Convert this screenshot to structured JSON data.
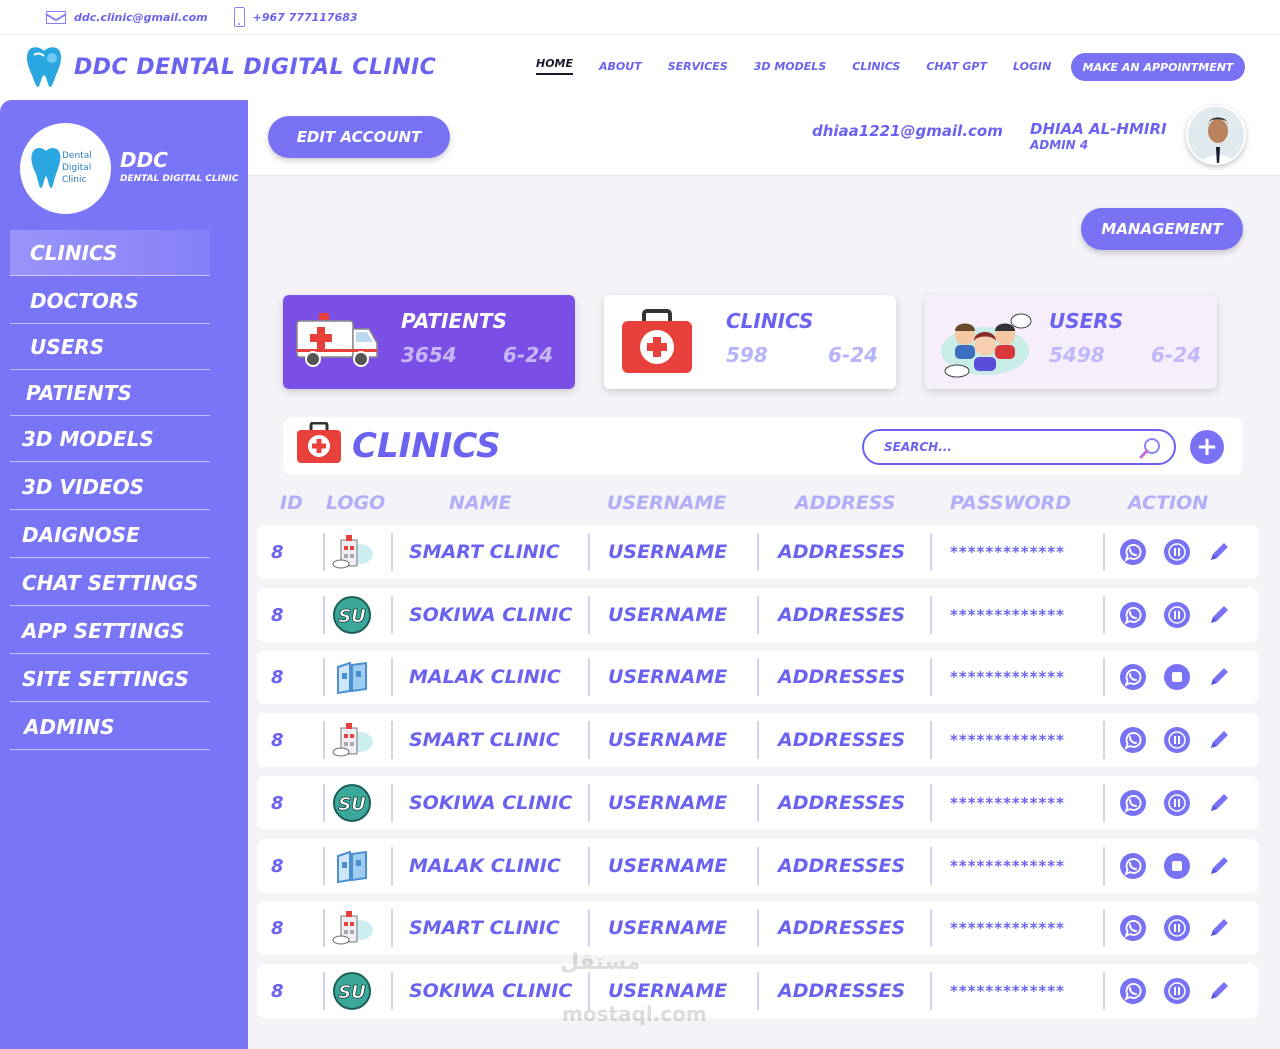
{
  "topbar": {
    "email": "ddc.clinic@gmail.com",
    "phone": "+967 777117683",
    "email_icon": "mail-icon",
    "phone_icon": "phone-icon"
  },
  "navbar": {
    "brand": "DDC DENTAL DIGITAL CLINIC",
    "links": [
      "HOME",
      "ABOUT",
      "SERVICES",
      "3D MODELS",
      "CLINICS",
      "CHAT GPT",
      "LOGIN"
    ],
    "active_link": "HOME",
    "cta": "MAKE AN APPOINTMENT"
  },
  "sidebar": {
    "brand_title": "DDC",
    "brand_subtitle": "DENTAL DIGITAL CLINIC",
    "logo_lines": [
      "Dental",
      "Digital",
      "Clinic"
    ],
    "items": [
      {
        "label": "CLINICS",
        "active": true
      },
      {
        "label": "DOCTORS",
        "active": false
      },
      {
        "label": "USERS",
        "active": false
      },
      {
        "label": "PATIENTS",
        "active": false
      },
      {
        "label": "3D MODELS",
        "active": false
      },
      {
        "label": "3D VIDEOS",
        "active": false
      },
      {
        "label": "DAIGNOSE",
        "active": false
      },
      {
        "label": "CHAT SETTINGS",
        "active": false
      },
      {
        "label": "APP SETTINGS",
        "active": false
      },
      {
        "label": "SITE SETTINGS",
        "active": false
      },
      {
        "label": "ADMINS",
        "active": false
      }
    ]
  },
  "header": {
    "edit_button": "EDIT ACCOUNT",
    "user_email": "dhiaa1221@gmail.com",
    "user_name": "DHIAA AL-HMIRI",
    "user_role": "ADMIN 4"
  },
  "main": {
    "management_button": "MANAGEMENT",
    "stats": [
      {
        "title": "PATIENTS",
        "value": "3654",
        "date": "6-24",
        "icon": "ambulance-icon"
      },
      {
        "title": "CLINICS",
        "value": "598",
        "date": "6-24",
        "icon": "first-aid-kit-icon"
      },
      {
        "title": "USERS",
        "value": "5498",
        "date": "6-24",
        "icon": "users-group-icon"
      }
    ],
    "section_title": "CLINICS",
    "search_placeholder": "SEARCH...",
    "add_button": "+",
    "columns": [
      "ID",
      "LOGO",
      "NAME",
      "USERNAME",
      "ADDRESS",
      "PASSWORD",
      "ACTION"
    ],
    "rows": [
      {
        "id": "8",
        "logo": "smart-clinic-logo",
        "name": "SMART CLINIC",
        "username": "USERNAME",
        "address": "ADDRESSES",
        "password": "*************",
        "status": "pause"
      },
      {
        "id": "8",
        "logo": "sokiwa-clinic-logo",
        "name": "SOKIWA CLINIC",
        "username": "USERNAME",
        "address": "ADDRESSES",
        "password": "*************",
        "status": "pause"
      },
      {
        "id": "8",
        "logo": "malak-clinic-logo",
        "name": "MALAK CLINIC",
        "username": "USERNAME",
        "address": "ADDRESSES",
        "password": "*************",
        "status": "stop"
      },
      {
        "id": "8",
        "logo": "smart-clinic-logo",
        "name": "SMART CLINIC",
        "username": "USERNAME",
        "address": "ADDRESSES",
        "password": "*************",
        "status": "pause"
      },
      {
        "id": "8",
        "logo": "sokiwa-clinic-logo",
        "name": "SOKIWA CLINIC",
        "username": "USERNAME",
        "address": "ADDRESSES",
        "password": "*************",
        "status": "pause"
      },
      {
        "id": "8",
        "logo": "malak-clinic-logo",
        "name": "MALAK CLINIC",
        "username": "USERNAME",
        "address": "ADDRESSES",
        "password": "*************",
        "status": "stop"
      },
      {
        "id": "8",
        "logo": "smart-clinic-logo",
        "name": "SMART CLINIC",
        "username": "USERNAME",
        "address": "ADDRESSES",
        "password": "*************",
        "status": "pause"
      },
      {
        "id": "8",
        "logo": "sokiwa-clinic-logo",
        "name": "SOKIWA CLINIC",
        "username": "USERNAME",
        "address": "ADDRESSES",
        "password": "*************",
        "status": "pause"
      }
    ]
  },
  "watermark": {
    "arabic": "مستقل",
    "latin": "mostaql.com"
  },
  "colors": {
    "primary": "#7a72f5",
    "sidebar": "#7a74f6",
    "text": "#6b63f0",
    "whatsapp": "#7a72f5"
  }
}
